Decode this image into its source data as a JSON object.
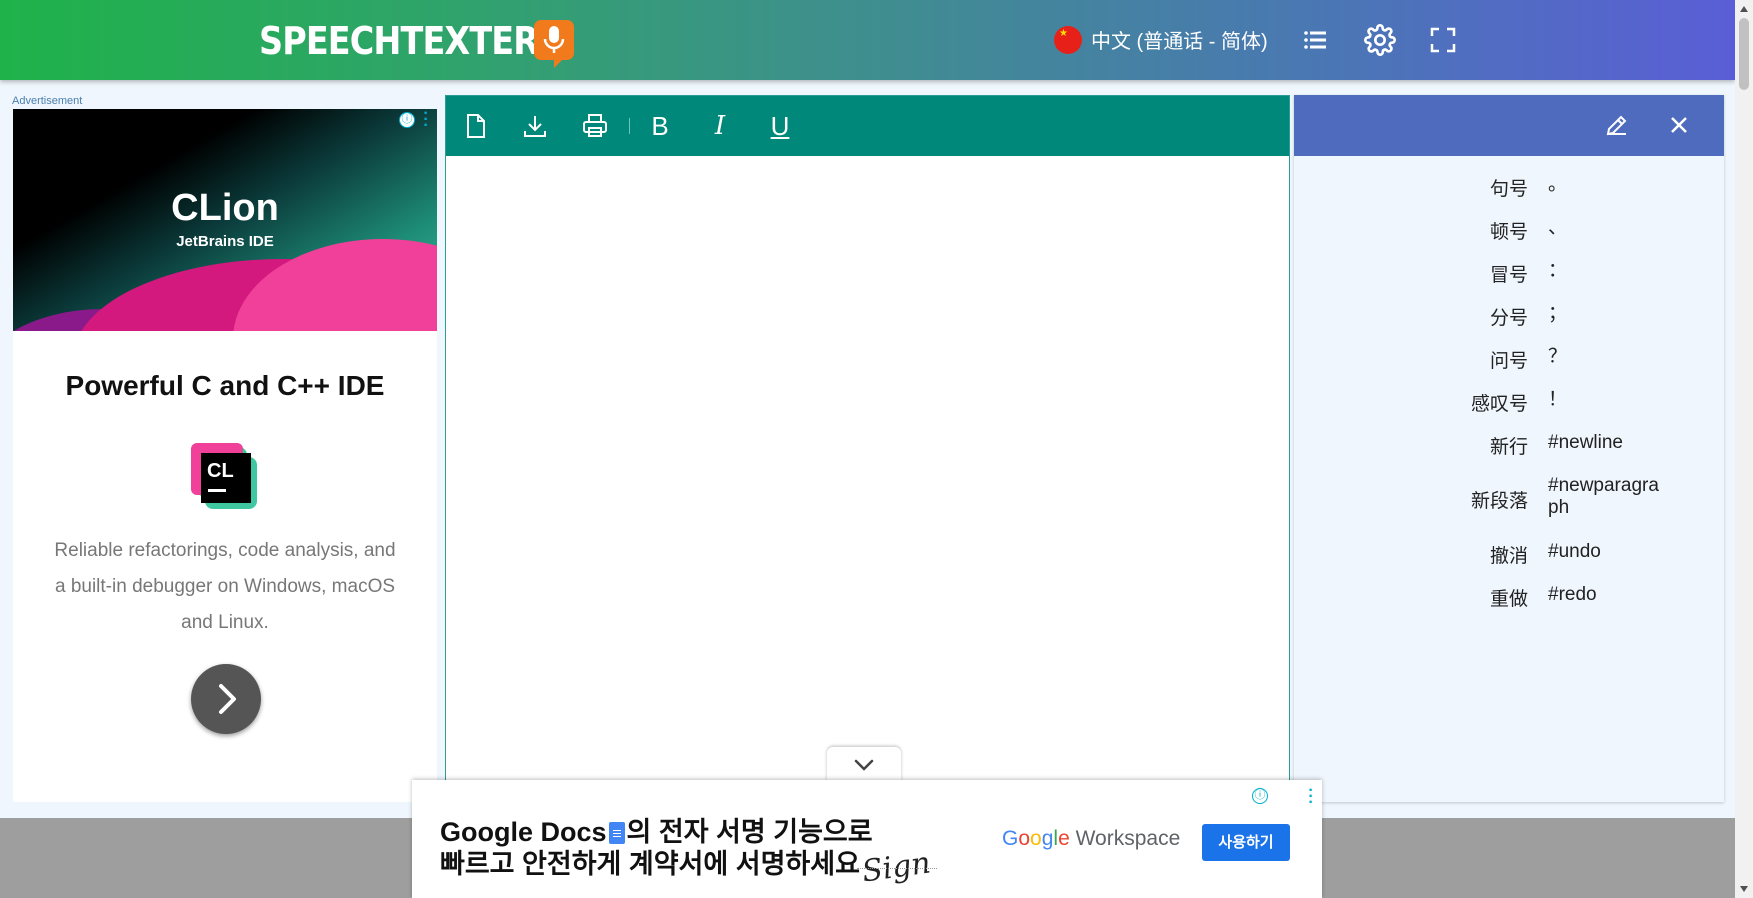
{
  "header": {
    "logo_text": "SPEECHTEXTER",
    "language": "中文 (普通话 - 简体)",
    "icons": [
      "commands-list-icon",
      "settings-gear-icon",
      "fullscreen-icon"
    ]
  },
  "side_ad": {
    "label": "Advertisement",
    "banner_title": "CLion",
    "banner_subtitle": "JetBrains IDE",
    "headline": "Powerful C and C++ IDE",
    "logo_text": "CL",
    "description": "Reliable refactorings, code analysis, and a built-in debugger on Windows, macOS and Linux.",
    "info_icon": "ⓘ"
  },
  "editor": {
    "toolbar": {
      "bold": "B",
      "italic": "I",
      "underline": "U"
    },
    "content": ""
  },
  "commands_panel": {
    "commands": [
      {
        "key": "句号",
        "value": "。"
      },
      {
        "key": "顿号",
        "value": "、"
      },
      {
        "key": "冒号",
        "value": "："
      },
      {
        "key": "分号",
        "value": "；"
      },
      {
        "key": "问号",
        "value": "？"
      },
      {
        "key": "感叹号",
        "value": "！"
      },
      {
        "key": "新行",
        "value": "#newline"
      },
      {
        "key": "新段落",
        "value": "#newparagraph"
      },
      {
        "key": "撤消",
        "value": "#undo"
      },
      {
        "key": "重做",
        "value": "#redo"
      }
    ]
  },
  "bottom_ad": {
    "line1_a": "Google Docs",
    "line1_b": "의 전자 서명 기능으로",
    "line2": "빠르고 안전하게 계약서에 서명하세요",
    "sign_text": "Sign",
    "workspace": "Workspace",
    "cta": "사용하기"
  },
  "colors": {
    "toolbar": "#00897b",
    "panel_header": "#4f6bbd",
    "header_gradient_start": "#1fb24a",
    "header_gradient_end": "#5a5ed6"
  }
}
